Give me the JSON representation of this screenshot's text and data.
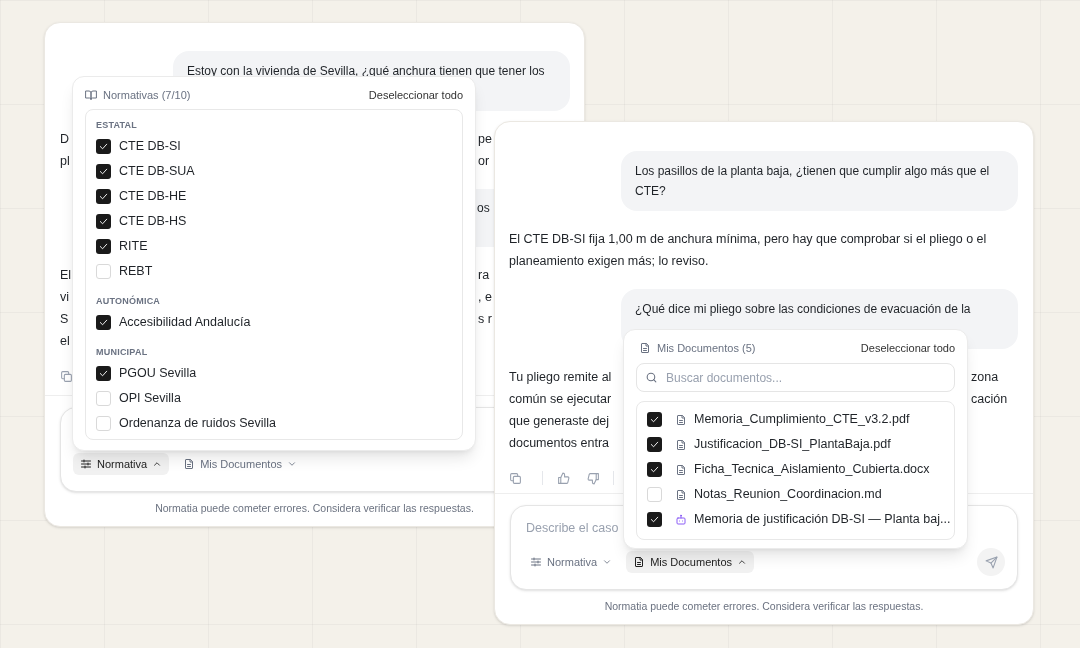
{
  "windows": [
    {
      "messages": [
        {
          "kind": "user",
          "lines": [
            "Estoy con la vivienda de Sevilla, ¿qué anchura tienen que tener los"
          ]
        },
        {
          "kind": "assistant",
          "lines": [
            {
              "left": "D",
              "right": "pe"
            },
            {
              "left": "pl",
              "right": "or"
            }
          ]
        },
        {
          "kind": "user_partial",
          "text": "os"
        },
        {
          "kind": "assistant",
          "lines": [
            {
              "left": "El",
              "right": "ra"
            },
            {
              "left": "vi",
              "right": ", e"
            },
            {
              "left": "S",
              "right": "s r"
            },
            {
              "left": "el"
            }
          ]
        }
      ],
      "composer": {
        "chips": [
          {
            "label": "Normativa",
            "kind": "normativa",
            "open": true
          },
          {
            "label": "Mis Documentos",
            "kind": "documents",
            "open": false
          }
        ]
      },
      "disclaimer": "Normatia puede cometer errores. Considera verificar las respuestas."
    },
    {
      "messages": [
        {
          "kind": "user",
          "lines": [
            "Los pasillos de la planta baja, ¿tienen que cumplir algo más que el",
            "CTE?"
          ]
        },
        {
          "kind": "assistant",
          "lines": [
            {
              "left": "El CTE DB-SI fija 1,00 m de anchura mínima, pero hay que comprobar si el pliego o el"
            },
            {
              "left": "planeamiento exigen más; lo reviso."
            }
          ]
        },
        {
          "kind": "user",
          "lines": [
            "¿Qué dice mi pliego sobre las condiciones de evacuación de la"
          ]
        },
        {
          "kind": "assistant",
          "lines": [
            {
              "left": "Tu pliego remite al",
              "right": "zona"
            },
            {
              "left": "común se ejecutar",
              "right": "cación"
            },
            {
              "left": "que generaste dej"
            },
            {
              "left": "documentos entra"
            }
          ]
        }
      ],
      "composer": {
        "placeholder": "Describe el caso",
        "chips": [
          {
            "label": "Normativa",
            "kind": "normativa",
            "open": false
          },
          {
            "label": "Mis Documentos",
            "kind": "documents",
            "open": true
          }
        ]
      },
      "disclaimer": "Normatia puede cometer errores. Considera verificar las respuestas."
    }
  ],
  "normativas_popover": {
    "title": "Normativas (7/10)",
    "action": "Deseleccionar todo",
    "groups": [
      {
        "label": "ESTATAL",
        "items": [
          {
            "label": "CTE DB-SI",
            "checked": true
          },
          {
            "label": "CTE DB-SUA",
            "checked": true
          },
          {
            "label": "CTE DB-HE",
            "checked": true
          },
          {
            "label": "CTE DB-HS",
            "checked": true
          },
          {
            "label": "RITE",
            "checked": true
          },
          {
            "label": "REBT",
            "checked": false
          }
        ]
      },
      {
        "label": "AUTONÓMICA",
        "items": [
          {
            "label": "Accesibilidad Andalucía",
            "checked": true
          }
        ]
      },
      {
        "label": "MUNICIPAL",
        "items": [
          {
            "label": "PGOU Sevilla",
            "checked": true
          },
          {
            "label": "OPI Sevilla",
            "checked": false
          },
          {
            "label": "Ordenanza de ruidos Sevilla",
            "checked": false
          }
        ]
      }
    ]
  },
  "documents_popover": {
    "title": "Mis Documentos (5)",
    "action": "Deseleccionar todo",
    "search": {
      "placeholder": "Buscar documentos..."
    },
    "items": [
      {
        "kind": "file",
        "name": "Memoria_Cumplimiento_CTE_v3.2.pdf",
        "checked": true
      },
      {
        "kind": "file",
        "name": "Justificacion_DB-SI_PlantaBaja.pdf",
        "checked": true
      },
      {
        "kind": "file",
        "name": "Ficha_Tecnica_Aislamiento_Cubierta.docx",
        "checked": true
      },
      {
        "kind": "file",
        "name": "Notas_Reunion_Coordinacion.md",
        "checked": false
      },
      {
        "kind": "generated",
        "name": "Memoria de justificación DB-SI — Planta baj...",
        "checked": true
      }
    ]
  }
}
